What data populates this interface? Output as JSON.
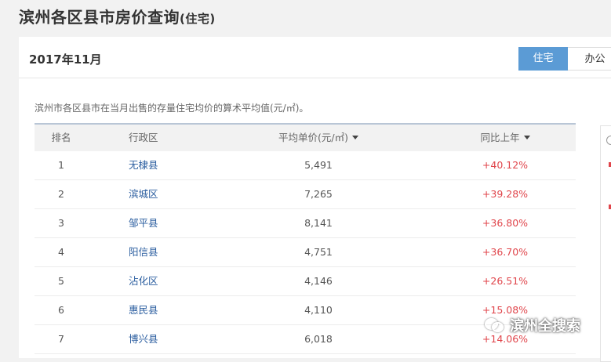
{
  "page": {
    "title": "滨州各区县市房价查询",
    "title_suffix": "(住宅)"
  },
  "card": {
    "date": "2017年11月",
    "tabs": [
      {
        "label": "住宅",
        "active": true
      },
      {
        "label": "办公",
        "active": false
      }
    ],
    "description": "滨州市各区县市在当月出售的存量住宅均价的算术平均值(元/㎡)。"
  },
  "table": {
    "headers": {
      "rank": "排名",
      "district": "行政区",
      "price": "平均单价(元/㎡)",
      "yoy": "同比上年"
    },
    "rows": [
      {
        "rank": "1",
        "district": "无棣县",
        "price": "5,491",
        "yoy": "+40.12%"
      },
      {
        "rank": "2",
        "district": "滨城区",
        "price": "7,265",
        "yoy": "+39.28%"
      },
      {
        "rank": "3",
        "district": "邹平县",
        "price": "8,141",
        "yoy": "+36.80%"
      },
      {
        "rank": "4",
        "district": "阳信县",
        "price": "4,751",
        "yoy": "+36.70%"
      },
      {
        "rank": "5",
        "district": "沾化区",
        "price": "4,146",
        "yoy": "+26.51%"
      },
      {
        "rank": "6",
        "district": "惠民县",
        "price": "4,110",
        "yoy": "+15.08%"
      },
      {
        "rank": "7",
        "district": "博兴县",
        "price": "6,018",
        "yoy": "+14.06%"
      }
    ]
  },
  "watermark": {
    "text": "滨州全搜索",
    "icon": "wechat-icon"
  },
  "colors": {
    "accent": "#5b9bd5",
    "increase": "#e0454b",
    "link": "#2a5d9f"
  }
}
